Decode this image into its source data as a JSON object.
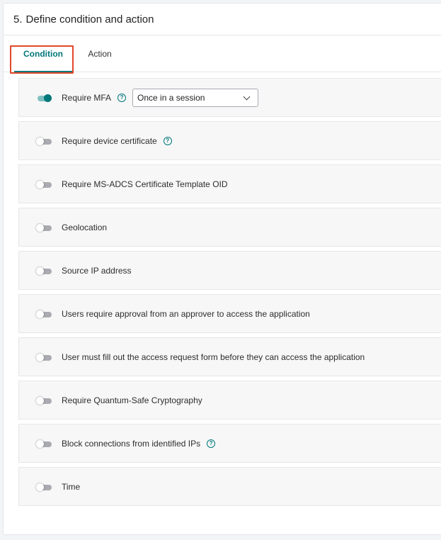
{
  "section": {
    "number": "5.",
    "title": "Define condition and action"
  },
  "tabs": [
    {
      "label": "Condition",
      "active": true
    },
    {
      "label": "Action",
      "active": false
    }
  ],
  "conditions": [
    {
      "label": "Require MFA",
      "enabled": true,
      "help": true,
      "select_value": "Once in a session"
    },
    {
      "label": "Require device certificate",
      "enabled": false,
      "help": true
    },
    {
      "label": "Require MS-ADCS Certificate Template OID",
      "enabled": false,
      "help": false
    },
    {
      "label": "Geolocation",
      "enabled": false,
      "help": false
    },
    {
      "label": "Source IP address",
      "enabled": false,
      "help": false
    },
    {
      "label": "Users require approval from an approver to access the application",
      "enabled": false,
      "help": false
    },
    {
      "label": "User must fill out the access request form before they can access the application",
      "enabled": false,
      "help": false
    },
    {
      "label": "Require Quantum-Safe Cryptography",
      "enabled": false,
      "help": false
    },
    {
      "label": "Block connections from identified IPs",
      "enabled": false,
      "help": true
    },
    {
      "label": "Time",
      "enabled": false,
      "help": false
    }
  ],
  "icons": {
    "help": "help-circle-icon",
    "dropdown": "chevron-down-icon"
  },
  "colors": {
    "accent": "#00777a",
    "highlight": "#e0482a",
    "toggle_off": "#a9abb0"
  }
}
